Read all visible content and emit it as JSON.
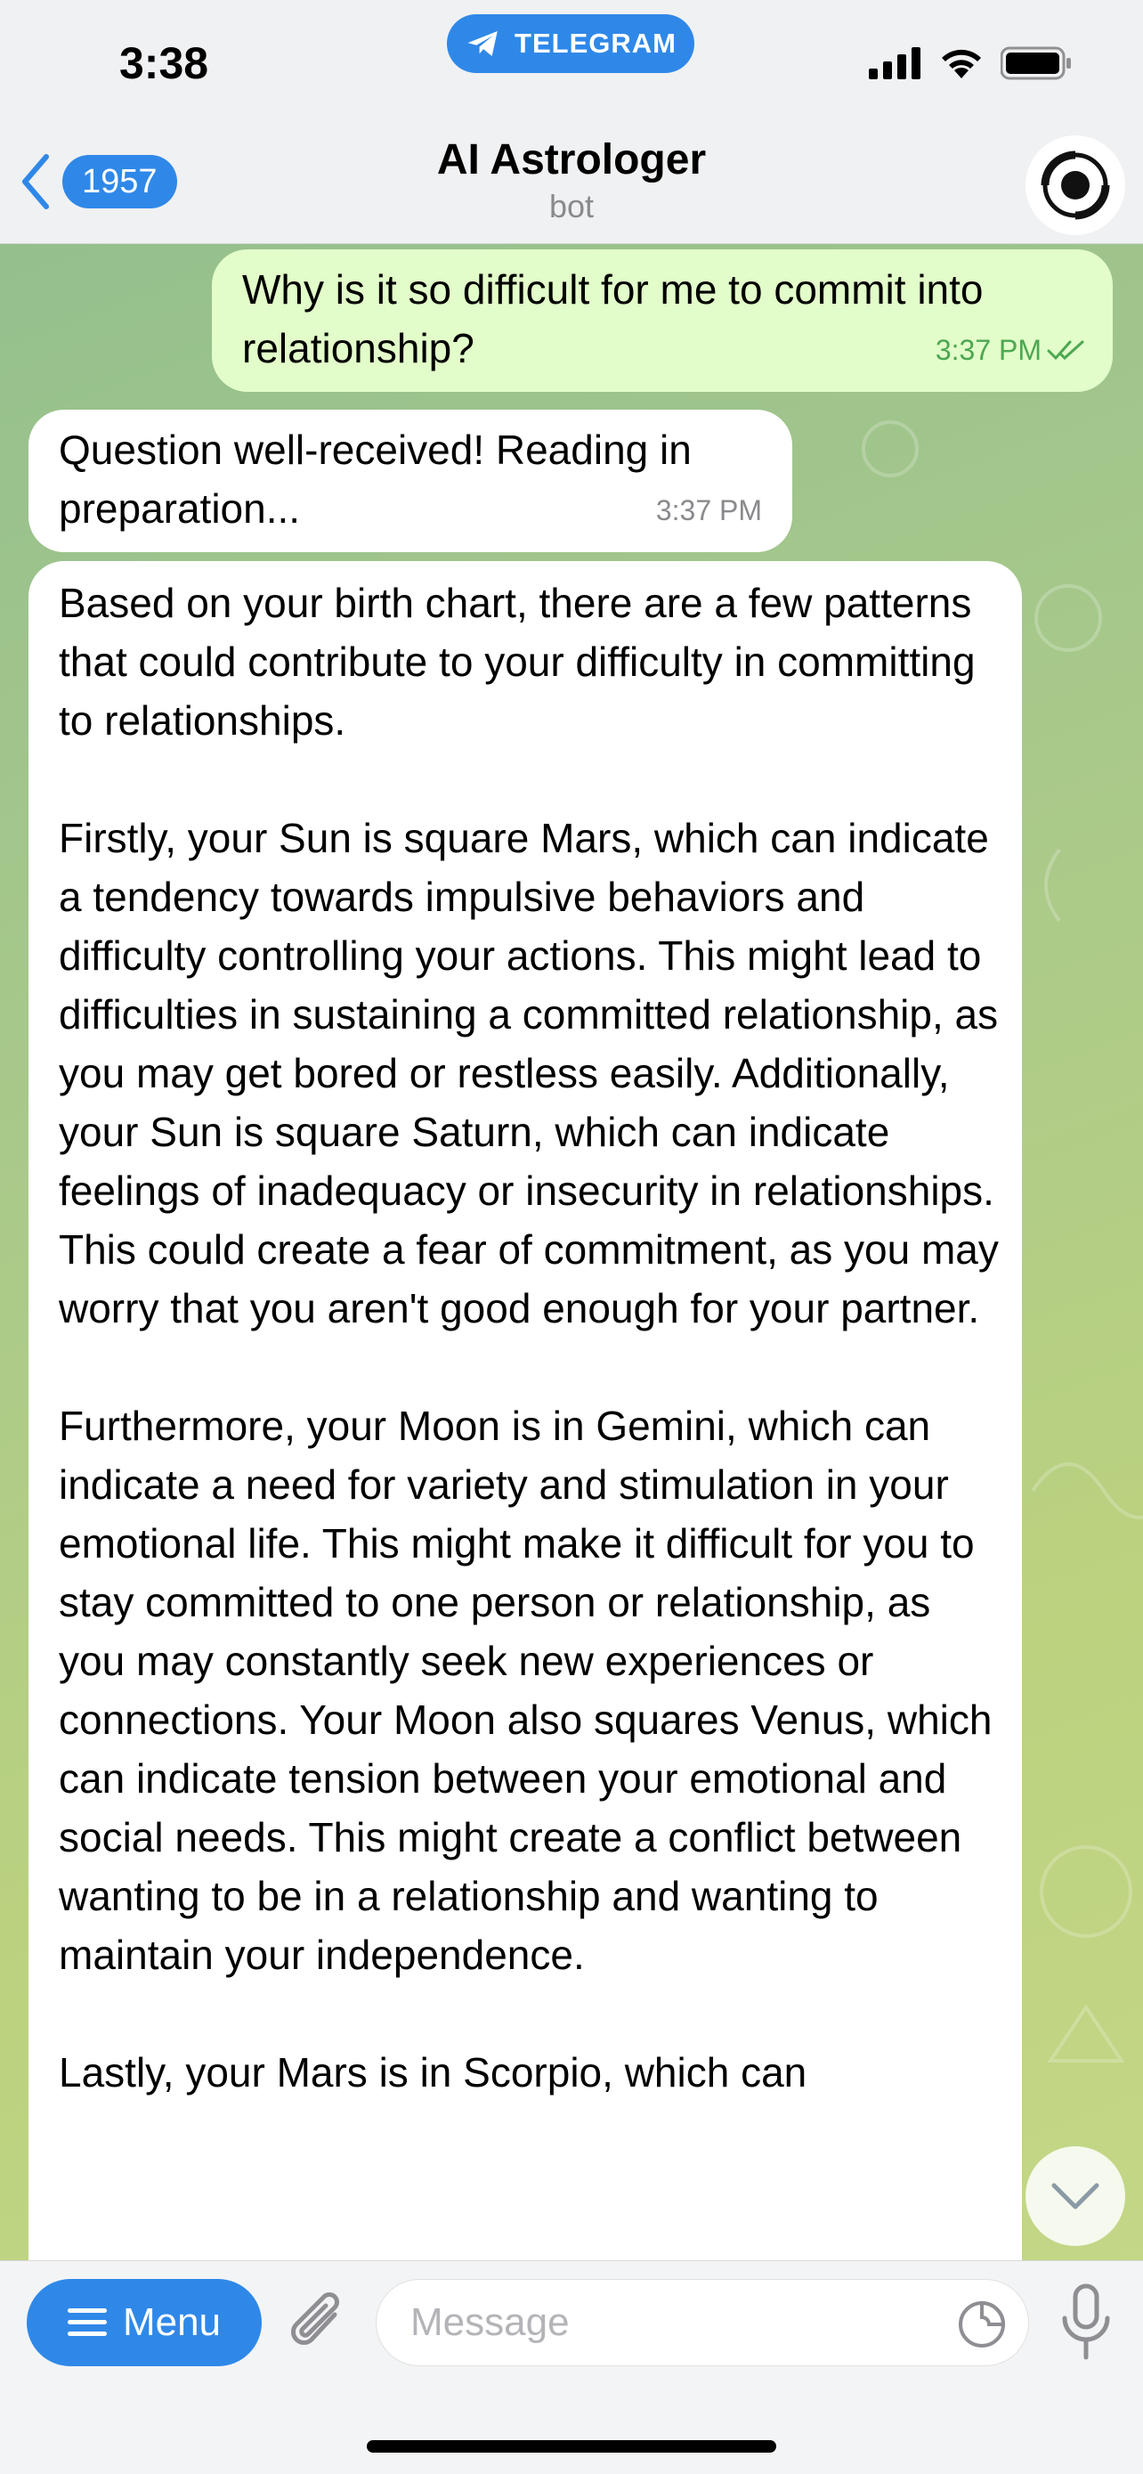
{
  "status_bar": {
    "time": "3:38",
    "app_pill": "TELEGRAM"
  },
  "header": {
    "back_count": "1957",
    "title": "AI Astrologer",
    "subtitle": "bot"
  },
  "messages": [
    {
      "side": "out",
      "text": "Why is it so difficult for me to commit into relationship?",
      "time": "3:37 PM"
    },
    {
      "side": "in",
      "text": "Question well-received! Reading in preparation...",
      "time": "3:37 PM"
    },
    {
      "side": "in",
      "text": "Based on your birth chart, there are a few patterns that could contribute to your difficulty in committing to relationships.\n\nFirstly, your Sun is square Mars, which can indicate a tendency towards impulsive behaviors and difficulty controlling your actions. This might lead to difficulties in sustaining a committed relationship, as you may get bored or restless easily. Additionally, your Sun is square Saturn, which can indicate feelings of inadequacy or insecurity in relationships. This could create a fear of commitment, as you may worry that you aren't good enough for your partner.\n\nFurthermore, your Moon is in Gemini, which can indicate a need for variety and stimulation in your emotional life. This might make it difficult for you to stay committed to one person or relationship, as you may constantly seek new experiences or connections. Your Moon also squares Venus, which can indicate tension between your emotional and social needs. This might create a conflict between wanting to be in a relationship and wanting to maintain your independence.\n\nLastly, your Mars is in Scorpio, which can"
    }
  ],
  "input_bar": {
    "menu_label": "Menu",
    "placeholder": "Message"
  },
  "colors": {
    "accent": "#2f88e8",
    "outgoing_bubble": "#e2fdc9",
    "incoming_bubble": "#ffffff",
    "read_check": "#4ca752"
  }
}
